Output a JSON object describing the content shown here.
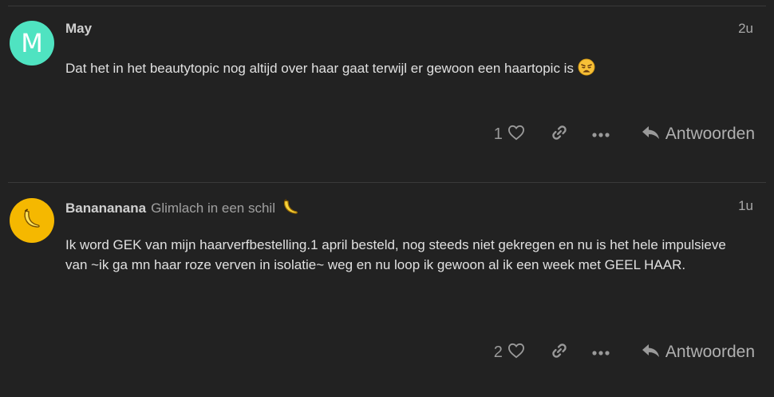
{
  "posts": [
    {
      "avatar_letter": "M",
      "avatar_color": "#4fe3c1",
      "username": "May",
      "user_title": "",
      "date": "2u",
      "body": "Dat het in het beautytopic nog altijd over haar gaat terwijl er gewoon een haartopic is",
      "body_emoji": "weary-face-emoji",
      "like_count": "1",
      "reply_label": "Antwoorden"
    },
    {
      "avatar_letter": "",
      "avatar_color": "#f5b800",
      "avatar_icon": "banana-icon",
      "username": "Banananana",
      "user_title": "Glimlach in een schil",
      "title_emoji": "banana-emoji",
      "date": "1u",
      "body": "Ik word GEK van mijn haarverfbestelling.1 april besteld, nog steeds niet gekregen en nu is het hele impulsieve van ~ik ga mn haar roze verven in isolatie~ weg en nu loop ik gewoon al ik een week met GEEL HAAR.",
      "like_count": "2",
      "reply_label": "Antwoorden"
    }
  ]
}
